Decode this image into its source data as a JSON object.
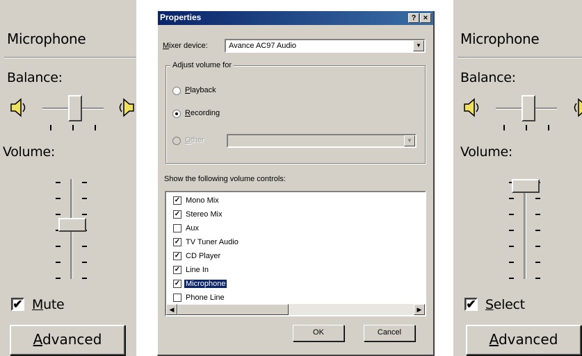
{
  "left_panel": {
    "title": "Microphone",
    "balance_label": "Balance:",
    "volume_label": "Volume:",
    "checkbox_label_pre": "",
    "checkbox_label_u": "M",
    "checkbox_label_post": "ute",
    "checkbox_checked_glyph": "✔",
    "advanced_u": "A",
    "advanced_post": "dvanced",
    "balance_level": 0.55,
    "volume_level": 0.55
  },
  "right_panel": {
    "title": "Microphone",
    "balance_label": "Balance:",
    "volume_label": "Volume:",
    "checkbox_label_u": "S",
    "checkbox_label_post": "elect",
    "checkbox_checked_glyph": "✔",
    "advanced_u": "A",
    "advanced_post": "dvanced",
    "balance_level": 0.55,
    "volume_level": 1.0
  },
  "dialog": {
    "title": "Properties",
    "help_btn": "?",
    "close_btn": "×",
    "mixer_label_u": "M",
    "mixer_label_post": "ixer device:",
    "mixer_value": "Avance AC97 Audio",
    "group_title": "Adjust volume for",
    "radio_playback_u": "P",
    "radio_playback_post": "layback",
    "radio_recording_u": "R",
    "radio_recording_post": "ecording",
    "radio_other_u": "O",
    "radio_other_post": "ther",
    "selected_radio": "Recording",
    "list_label": "Show the following volume controls:",
    "list_items": [
      {
        "label": "Mono Mix",
        "checked": true
      },
      {
        "label": "Stereo Mix",
        "checked": true
      },
      {
        "label": "Aux",
        "checked": false
      },
      {
        "label": "TV Tuner Audio",
        "checked": true
      },
      {
        "label": "CD Player",
        "checked": true
      },
      {
        "label": "Line In",
        "checked": true
      },
      {
        "label": "Microphone",
        "checked": true
      },
      {
        "label": "Phone Line",
        "checked": false
      }
    ],
    "selected_item": "Microphone",
    "ok_label": "OK",
    "cancel_label": "Cancel"
  },
  "icons": {
    "speaker_left": "speaker-left-icon",
    "speaker_right": "speaker-right-icon"
  },
  "colors": {
    "face": "#d4d0c8",
    "title_bar": "#0a246a",
    "selection": "#0a246a",
    "speaker": "#f0e060"
  }
}
